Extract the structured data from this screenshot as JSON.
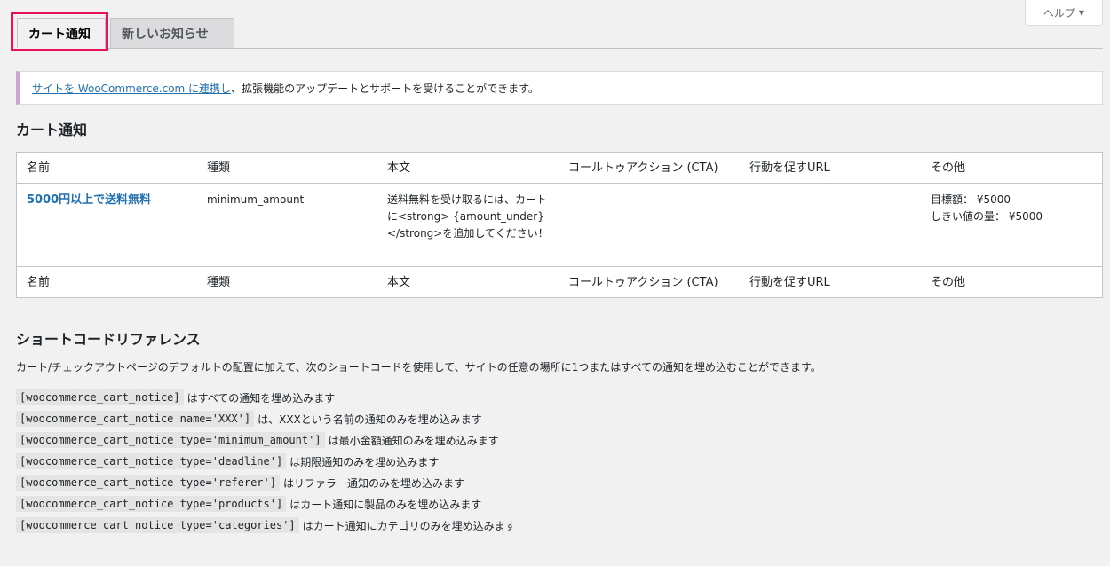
{
  "help": {
    "label": "ヘルプ",
    "caret_icon": "caret-down-icon"
  },
  "tabs": [
    {
      "label": "カート通知"
    },
    {
      "label": "新しいお知らせ"
    }
  ],
  "notice": {
    "link_text": "サイトを WooCommerce.com に連携し",
    "rest_text": "、拡張機能のアップデートとサポートを受けることができます。"
  },
  "cart_notices": {
    "title": "カート通知",
    "columns": [
      "名前",
      "種類",
      "本文",
      "コールトゥアクション (CTA)",
      "行動を促すURL",
      "その他"
    ],
    "rows": [
      {
        "name": "5000円以上で送料無料",
        "type": "minimum_amount",
        "body": "送料無料を受け取るには、カートに<strong> {amount_under}</strong>を追加してください！",
        "cta": "",
        "url": "",
        "other_target": "目標額： ¥5000",
        "other_threshold": "しきい値の量： ¥5000"
      }
    ]
  },
  "shortcode_ref": {
    "title": "ショートコードリファレンス",
    "description": "カート/チェックアウトページのデフォルトの配置に加えて、次のショートコードを使用して、サイトの任意の場所に1つまたはすべての通知を埋め込むことができます。",
    "items": [
      {
        "code": "[woocommerce_cart_notice]",
        "text": "はすべての通知を埋め込みます"
      },
      {
        "code": "[woocommerce_cart_notice name='XXX']",
        "text": "は、XXXという名前の通知のみを埋め込みます"
      },
      {
        "code": "[woocommerce_cart_notice type='minimum_amount']",
        "text": "は最小金額通知のみを埋め込みます"
      },
      {
        "code": "[woocommerce_cart_notice type='deadline']",
        "text": "は期限通知のみを埋め込みます"
      },
      {
        "code": "[woocommerce_cart_notice type='referer']",
        "text": "はリファラー通知のみを埋め込みます"
      },
      {
        "code": "[woocommerce_cart_notice type='products']",
        "text": "はカート通知に製品のみを埋め込みます"
      },
      {
        "code": "[woocommerce_cart_notice type='categories']",
        "text": "はカート通知にカテゴリのみを埋め込みます"
      }
    ]
  },
  "colors": {
    "link": "#2271b1",
    "highlight": "#e6115a",
    "notice_border": "#c9a6d6"
  }
}
